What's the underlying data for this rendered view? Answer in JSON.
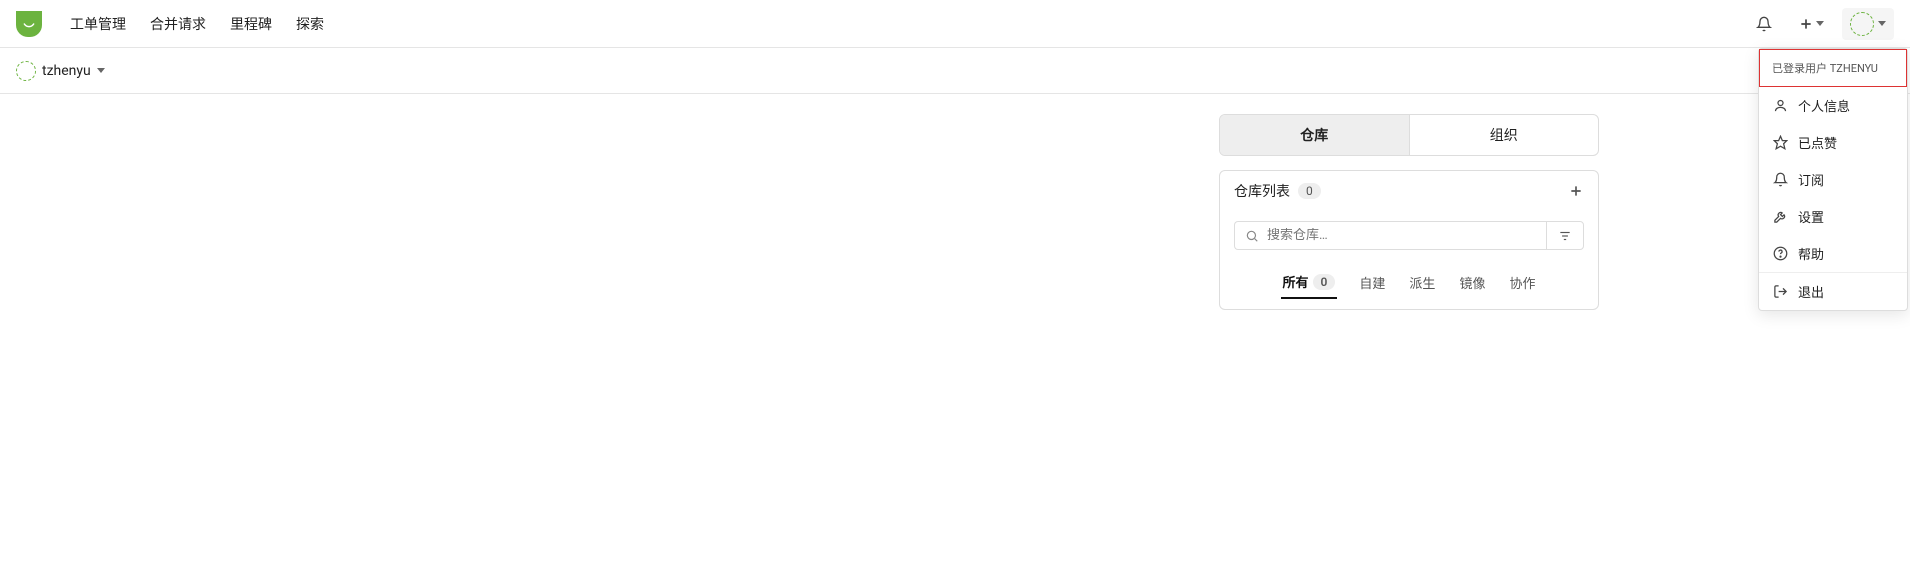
{
  "nav": {
    "items": [
      "工单管理",
      "合并请求",
      "里程碑",
      "探索"
    ]
  },
  "user": {
    "name": "tzhenyu"
  },
  "dropdown": {
    "header_prefix": "已登录用户",
    "header_user": "TZHENYU",
    "profile": "个人信息",
    "starred": "已点赞",
    "subscriptions": "订阅",
    "settings": "设置",
    "help": "帮助",
    "logout": "退出"
  },
  "tabs": {
    "repo": "仓库",
    "org": "组织"
  },
  "repo_panel": {
    "title": "仓库列表",
    "count": "0",
    "search_placeholder": "搜索仓库…",
    "filters": {
      "all": "所有",
      "all_count": "0",
      "sources": "自建",
      "forks": "派生",
      "mirrors": "镜像",
      "collab": "协作"
    }
  }
}
